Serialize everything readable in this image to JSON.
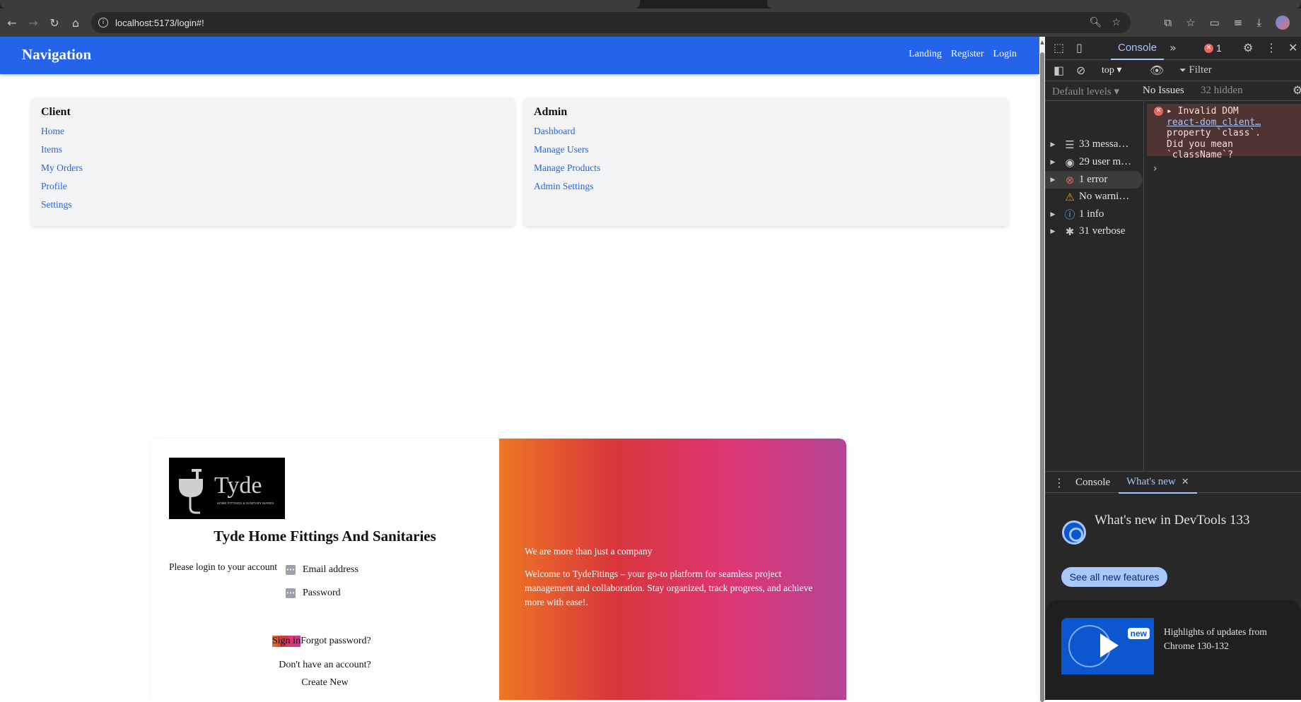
{
  "browser": {
    "url": "localhost:5173/login#!"
  },
  "navbar": {
    "brand": "Navigation",
    "links": [
      "Landing",
      "Register",
      "Login"
    ]
  },
  "client_card": {
    "title": "Client",
    "links": [
      "Home",
      "Items",
      "My Orders",
      "Profile",
      "Settings"
    ]
  },
  "admin_card": {
    "title": "Admin",
    "links": [
      "Dashboard",
      "Manage Users",
      "Manage Products",
      "Admin Settings"
    ]
  },
  "login": {
    "logo_text": "Tyde",
    "logo_subtext": "HOME FITTINGS & SANITARY WARES",
    "company": "Tyde Home Fittings And Sanitaries",
    "prompt": "Please login to your account",
    "email_label": "Email address",
    "password_label": "Password",
    "signin": "Sign in",
    "forgot": "Forgot password?",
    "no_account": "Don't have an account?",
    "create_new": "Create New",
    "tagline": "We are more than just a company",
    "welcome": "Welcome to TydeFitings – your go-to platform for seamless project management and collaboration. Stay organized, track progress, and achieve more with ease!."
  },
  "devtools": {
    "active_tab": "Console",
    "error_count": "1",
    "context": "top",
    "filter_placeholder": "Filter",
    "levels": "Default levels",
    "issues": "No Issues",
    "hidden": "32 hidden",
    "sidebar": [
      {
        "label": "33 messa…",
        "icon": "list-icon"
      },
      {
        "label": "29 user m…",
        "icon": "user-icon"
      },
      {
        "label": "1 error",
        "icon": "error-icon"
      },
      {
        "label": "No warni…",
        "icon": "warning-icon"
      },
      {
        "label": "1 info",
        "icon": "info-icon"
      },
      {
        "label": "31 verbose",
        "icon": "bug-icon"
      }
    ],
    "error_message": {
      "line1": "Invalid DOM",
      "link": "react-dom_client…",
      "line3": "property `class`.",
      "line4": "Did you mean",
      "line5": "`className`?"
    },
    "drawer_tabs": [
      "Console",
      "What's new"
    ],
    "whats_new_title": "What's new in DevTools 133",
    "see_all": "See all new features",
    "new_badge": "new",
    "highlights": "Highlights of updates from Chrome 130-132"
  }
}
